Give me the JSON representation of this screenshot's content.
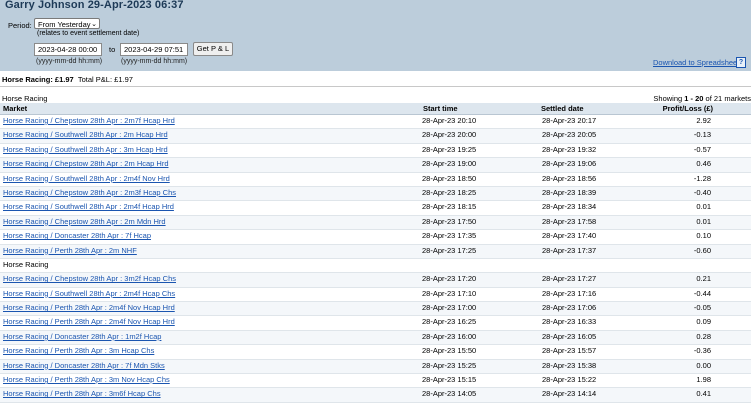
{
  "header": {
    "title": "Garry Johnson 29-Apr-2023 06:37",
    "period_label": "Period:",
    "period_value": "From Yesterday",
    "period_note": "(relates to event settlement date)",
    "from_value": "2023-04-28 00:00",
    "to_label": "to",
    "to_value": "2023-04-29 07:51",
    "button_label": "Get P & L",
    "from_hint": "(yyyy-mm-dd hh:mm)",
    "to_hint": "(yyyy-mm-dd hh:mm)",
    "download_label": "Download to Spreadsheet",
    "help_label": "?"
  },
  "summary": {
    "bold": "Horse Racing: £1.97",
    "total": "Total P&L: £1.97"
  },
  "section_title": "Horse Racing",
  "showing": {
    "prefix": "Showing ",
    "range": "1 - 20",
    "suffix": " of 21 markets"
  },
  "table": {
    "headers": [
      "Market",
      "Start time",
      "Settled date",
      "Profit/Loss (£)"
    ],
    "rows": [
      {
        "market": "Horse Racing / Chepstow 28th Apr : 2m7f Hcap Hrd",
        "start": "28-Apr-23 20:10",
        "settled": "28-Apr-23 20:17",
        "pl": "2.92",
        "link": true
      },
      {
        "market": "Horse Racing / Southwell 28th Apr : 2m Hcap Hrd",
        "start": "28-Apr-23 20:00",
        "settled": "28-Apr-23 20:05",
        "pl": "-0.13",
        "link": true
      },
      {
        "market": "Horse Racing / Southwell 28th Apr : 3m Hcap Hrd",
        "start": "28-Apr-23 19:25",
        "settled": "28-Apr-23 19:32",
        "pl": "-0.57",
        "link": true
      },
      {
        "market": "Horse Racing / Chepstow 28th Apr : 2m Hcap Hrd",
        "start": "28-Apr-23 19:00",
        "settled": "28-Apr-23 19:06",
        "pl": "0.46",
        "link": true
      },
      {
        "market": "Horse Racing / Southwell 28th Apr : 2m4f Nov Hrd",
        "start": "28-Apr-23 18:50",
        "settled": "28-Apr-23 18:56",
        "pl": "-1.28",
        "link": true
      },
      {
        "market": "Horse Racing / Chepstow 28th Apr : 2m3f Hcap Chs",
        "start": "28-Apr-23 18:25",
        "settled": "28-Apr-23 18:39",
        "pl": "-0.40",
        "link": true
      },
      {
        "market": "Horse Racing / Southwell 28th Apr : 2m4f Hcap Hrd",
        "start": "28-Apr-23 18:15",
        "settled": "28-Apr-23 18:34",
        "pl": "0.01",
        "link": true
      },
      {
        "market": "Horse Racing / Chepstow 28th Apr : 2m Mdn Hrd",
        "start": "28-Apr-23 17:50",
        "settled": "28-Apr-23 17:58",
        "pl": "0.01",
        "link": true
      },
      {
        "market": "Horse Racing / Doncaster 28th Apr : 7f Hcap",
        "start": "28-Apr-23 17:35",
        "settled": "28-Apr-23 17:40",
        "pl": "0.10",
        "link": true
      },
      {
        "market": "Horse Racing / Perth 28th Apr : 2m NHF",
        "start": "28-Apr-23 17:25",
        "settled": "28-Apr-23 17:37",
        "pl": "-0.60",
        "link": true
      },
      {
        "market": "Horse Racing",
        "start": "",
        "settled": "",
        "pl": "",
        "link": false
      },
      {
        "market": "Horse Racing / Chepstow 28th Apr : 3m2f Hcap Chs",
        "start": "28-Apr-23 17:20",
        "settled": "28-Apr-23 17:27",
        "pl": "0.21",
        "link": true
      },
      {
        "market": "Horse Racing / Southwell 28th Apr : 2m4f Hcap Chs",
        "start": "28-Apr-23 17:10",
        "settled": "28-Apr-23 17:16",
        "pl": "-0.44",
        "link": true
      },
      {
        "market": "Horse Racing / Perth 28th Apr : 2m4f Nov Hcap Hrd",
        "start": "28-Apr-23 17:00",
        "settled": "28-Apr-23 17:06",
        "pl": "-0.05",
        "link": true
      },
      {
        "market": "Horse Racing / Perth 28th Apr : 2m4f Nov Hcap Hrd",
        "start": "28-Apr-23 16:25",
        "settled": "28-Apr-23 16:33",
        "pl": "0.09",
        "link": true
      },
      {
        "market": "Horse Racing / Doncaster 28th Apr : 1m2f Hcap",
        "start": "28-Apr-23 16:00",
        "settled": "28-Apr-23 16:05",
        "pl": "0.28",
        "link": true
      },
      {
        "market": "Horse Racing / Perth 28th Apr : 3m Hcap Chs",
        "start": "28-Apr-23 15:50",
        "settled": "28-Apr-23 15:57",
        "pl": "-0.36",
        "link": true
      },
      {
        "market": "Horse Racing / Doncaster 28th Apr : 7f Mdn Stks",
        "start": "28-Apr-23 15:25",
        "settled": "28-Apr-23 15:38",
        "pl": "0.00",
        "link": true
      },
      {
        "market": "Horse Racing / Perth 28th Apr : 3m Nov Hcap Chs",
        "start": "28-Apr-23 15:15",
        "settled": "28-Apr-23 15:22",
        "pl": "1.98",
        "link": true
      },
      {
        "market": "Horse Racing / Perth 28th Apr : 3m6f Hcap Chs",
        "start": "28-Apr-23 14:05",
        "settled": "28-Apr-23 14:14",
        "pl": "0.41",
        "link": true
      }
    ]
  }
}
